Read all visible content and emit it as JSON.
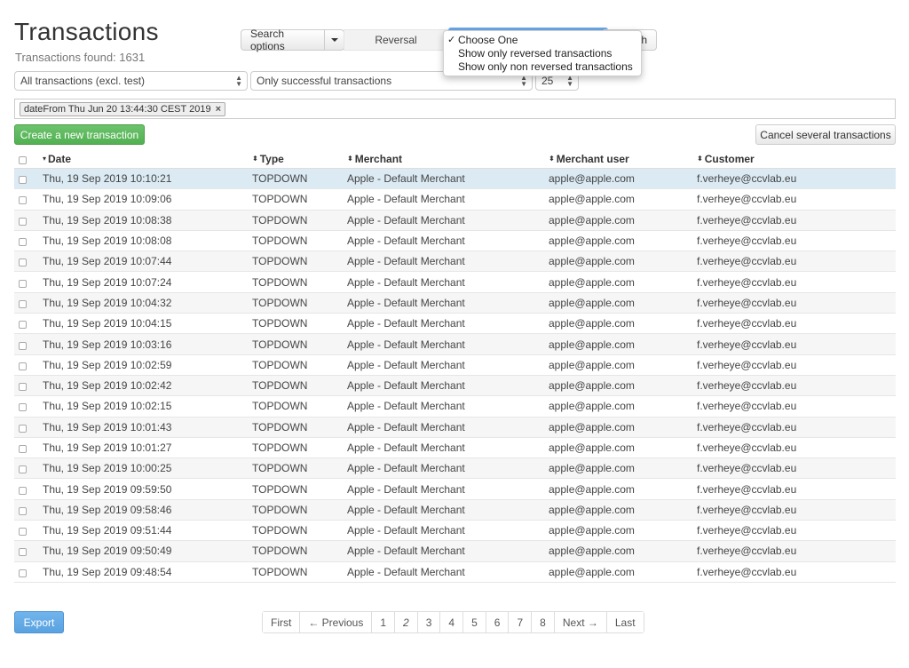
{
  "header": {
    "title": "Transactions",
    "found": "Transactions found: 1631"
  },
  "search_controls": {
    "search_options_label": "Search options",
    "reversal_label": "Reversal",
    "search_button_peek": "h"
  },
  "reversal_dropdown": {
    "options": [
      {
        "label": "Choose One",
        "checked": true
      },
      {
        "label": "Show only reversed transactions",
        "checked": false
      },
      {
        "label": "Show only non reversed transactions",
        "checked": false
      }
    ]
  },
  "filters": {
    "transaction_scope": "All transactions (excl. test)",
    "status_filter": "Only successful transactions",
    "page_size": "25",
    "chip": "dateFrom Thu Jun 20 13:44:30 CEST 2019",
    "chip_remove": "×"
  },
  "actions": {
    "create": "Create a new transaction",
    "cancel_several": "Cancel several transactions",
    "export": "Export"
  },
  "table": {
    "columns": [
      "Date",
      "Type",
      "Merchant",
      "Merchant user",
      "Customer"
    ],
    "sort_desc_icon": "▾",
    "sort_both_icon": "⬍",
    "rows": [
      {
        "date": "Thu, 19 Sep 2019 10:10:21",
        "type": "TOPDOWN",
        "merchant": "Apple - Default Merchant",
        "muser": "apple@apple.com",
        "customer": "f.verheye@ccvlab.eu"
      },
      {
        "date": "Thu, 19 Sep 2019 10:09:06",
        "type": "TOPDOWN",
        "merchant": "Apple - Default Merchant",
        "muser": "apple@apple.com",
        "customer": "f.verheye@ccvlab.eu"
      },
      {
        "date": "Thu, 19 Sep 2019 10:08:38",
        "type": "TOPDOWN",
        "merchant": "Apple - Default Merchant",
        "muser": "apple@apple.com",
        "customer": "f.verheye@ccvlab.eu"
      },
      {
        "date": "Thu, 19 Sep 2019 10:08:08",
        "type": "TOPDOWN",
        "merchant": "Apple - Default Merchant",
        "muser": "apple@apple.com",
        "customer": "f.verheye@ccvlab.eu"
      },
      {
        "date": "Thu, 19 Sep 2019 10:07:44",
        "type": "TOPDOWN",
        "merchant": "Apple - Default Merchant",
        "muser": "apple@apple.com",
        "customer": "f.verheye@ccvlab.eu"
      },
      {
        "date": "Thu, 19 Sep 2019 10:07:24",
        "type": "TOPDOWN",
        "merchant": "Apple - Default Merchant",
        "muser": "apple@apple.com",
        "customer": "f.verheye@ccvlab.eu"
      },
      {
        "date": "Thu, 19 Sep 2019 10:04:32",
        "type": "TOPDOWN",
        "merchant": "Apple - Default Merchant",
        "muser": "apple@apple.com",
        "customer": "f.verheye@ccvlab.eu"
      },
      {
        "date": "Thu, 19 Sep 2019 10:04:15",
        "type": "TOPDOWN",
        "merchant": "Apple - Default Merchant",
        "muser": "apple@apple.com",
        "customer": "f.verheye@ccvlab.eu"
      },
      {
        "date": "Thu, 19 Sep 2019 10:03:16",
        "type": "TOPDOWN",
        "merchant": "Apple - Default Merchant",
        "muser": "apple@apple.com",
        "customer": "f.verheye@ccvlab.eu"
      },
      {
        "date": "Thu, 19 Sep 2019 10:02:59",
        "type": "TOPDOWN",
        "merchant": "Apple - Default Merchant",
        "muser": "apple@apple.com",
        "customer": "f.verheye@ccvlab.eu"
      },
      {
        "date": "Thu, 19 Sep 2019 10:02:42",
        "type": "TOPDOWN",
        "merchant": "Apple - Default Merchant",
        "muser": "apple@apple.com",
        "customer": "f.verheye@ccvlab.eu"
      },
      {
        "date": "Thu, 19 Sep 2019 10:02:15",
        "type": "TOPDOWN",
        "merchant": "Apple - Default Merchant",
        "muser": "apple@apple.com",
        "customer": "f.verheye@ccvlab.eu"
      },
      {
        "date": "Thu, 19 Sep 2019 10:01:43",
        "type": "TOPDOWN",
        "merchant": "Apple - Default Merchant",
        "muser": "apple@apple.com",
        "customer": "f.verheye@ccvlab.eu"
      },
      {
        "date": "Thu, 19 Sep 2019 10:01:27",
        "type": "TOPDOWN",
        "merchant": "Apple - Default Merchant",
        "muser": "apple@apple.com",
        "customer": "f.verheye@ccvlab.eu"
      },
      {
        "date": "Thu, 19 Sep 2019 10:00:25",
        "type": "TOPDOWN",
        "merchant": "Apple - Default Merchant",
        "muser": "apple@apple.com",
        "customer": "f.verheye@ccvlab.eu"
      },
      {
        "date": "Thu, 19 Sep 2019 09:59:50",
        "type": "TOPDOWN",
        "merchant": "Apple - Default Merchant",
        "muser": "apple@apple.com",
        "customer": "f.verheye@ccvlab.eu"
      },
      {
        "date": "Thu, 19 Sep 2019 09:58:46",
        "type": "TOPDOWN",
        "merchant": "Apple - Default Merchant",
        "muser": "apple@apple.com",
        "customer": "f.verheye@ccvlab.eu"
      },
      {
        "date": "Thu, 19 Sep 2019 09:51:44",
        "type": "TOPDOWN",
        "merchant": "Apple - Default Merchant",
        "muser": "apple@apple.com",
        "customer": "f.verheye@ccvlab.eu"
      },
      {
        "date": "Thu, 19 Sep 2019 09:50:49",
        "type": "TOPDOWN",
        "merchant": "Apple - Default Merchant",
        "muser": "apple@apple.com",
        "customer": "f.verheye@ccvlab.eu"
      },
      {
        "date": "Thu, 19 Sep 2019 09:48:54",
        "type": "TOPDOWN",
        "merchant": "Apple - Default Merchant",
        "muser": "apple@apple.com",
        "customer": "f.verheye@ccvlab.eu"
      }
    ]
  },
  "pagination": {
    "first": "First",
    "previous": "← Previous",
    "pages": [
      "1",
      "2",
      "3",
      "4",
      "5",
      "6",
      "7",
      "8"
    ],
    "current": "2",
    "next": "Next →",
    "last": "Last"
  },
  "colors": {
    "create_button": "#5cb85c",
    "export_button": "#5aa2e0",
    "selected_row": "#dbeaf3",
    "accent_strip": "#6aa7e8"
  }
}
